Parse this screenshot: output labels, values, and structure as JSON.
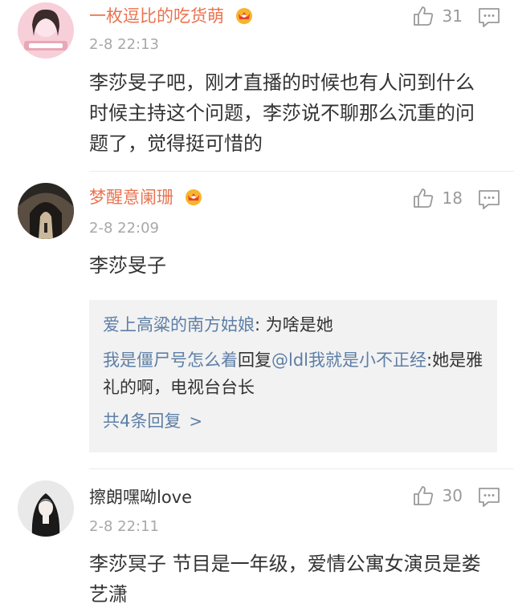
{
  "colors": {
    "username_orange": "#eb7350",
    "link_blue": "#5d7fa6",
    "meta_gray": "#a8a8a8",
    "reply_bg": "#f2f2f2"
  },
  "comments": [
    {
      "username": "一枚逗比的吃货萌",
      "badge": "vip-crown-icon",
      "timestamp": "2-8 22:13",
      "likes": "31",
      "text": "李莎旻子吧，刚才直播的时候也有人问到什么时候主持这个问题，李莎说不聊那么沉重的问题了，觉得挺可惜的"
    },
    {
      "username": "梦醒意阑珊",
      "badge": "vip-crown-icon",
      "timestamp": "2-8 22:09",
      "likes": "18",
      "text": "李莎旻子",
      "replies": [
        {
          "name": "爱上高粱的南方姑娘",
          "sep": ": ",
          "text": "为啥是她"
        },
        {
          "name": "我是僵尸号怎么着",
          "mid": "回复",
          "target": "@ldl我就是小不正经",
          "sep": ":",
          "text": "她是雅礼的啊，电视台台长"
        }
      ],
      "more_label": "共4条回复",
      "more_chevron": ">"
    },
    {
      "username": "擦朗嘿呦love",
      "timestamp": "2-8 22:11",
      "likes": "30",
      "text": "李莎冥子 节目是一年级，爱情公寓女演员是娄艺潇"
    }
  ]
}
